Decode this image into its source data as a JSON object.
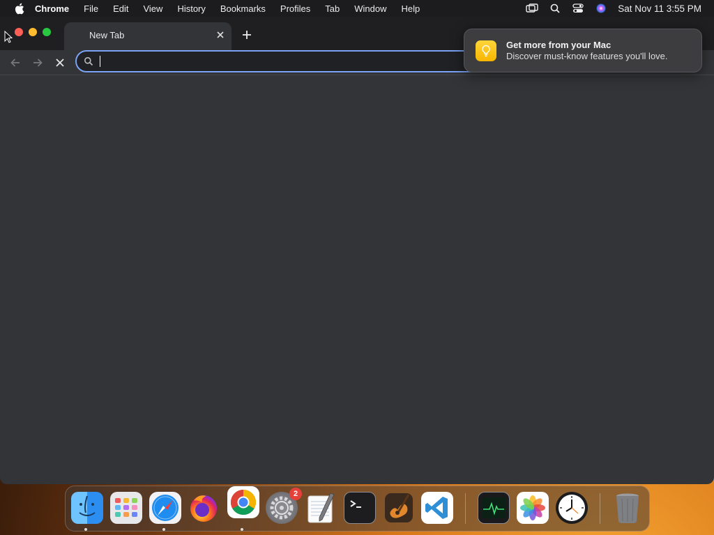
{
  "menubar": {
    "app_name": "Chrome",
    "items": [
      "File",
      "Edit",
      "View",
      "History",
      "Bookmarks",
      "Profiles",
      "Tab",
      "Window",
      "Help"
    ],
    "clock": "Sat Nov 11  3:55 PM"
  },
  "browser": {
    "tab_title": "New Tab",
    "omnibox_value": "",
    "omnibox_placeholder": ""
  },
  "notification": {
    "title": "Get more from your Mac",
    "body": "Discover must-know features you'll love."
  },
  "dock": {
    "apps": [
      {
        "name": "Finder",
        "icon": "finder-icon",
        "running": true
      },
      {
        "name": "Launchpad",
        "icon": "launchpad-icon",
        "running": false
      },
      {
        "name": "Safari",
        "icon": "safari-icon",
        "running": true
      },
      {
        "name": "Firefox",
        "icon": "firefox-icon",
        "running": false
      },
      {
        "name": "Google Chrome",
        "icon": "chrome-icon",
        "running": true
      },
      {
        "name": "System Settings",
        "icon": "settings-icon",
        "running": false,
        "badge": "2"
      },
      {
        "name": "TextEdit",
        "icon": "textedit-icon",
        "running": false
      },
      {
        "name": "Terminal",
        "icon": "terminal-icon",
        "running": false
      },
      {
        "name": "GarageBand",
        "icon": "garageband-icon",
        "running": false
      },
      {
        "name": "Visual Studio Code",
        "icon": "vscode-icon",
        "running": false
      },
      {
        "name": "Activity Monitor",
        "icon": "activity-monitor-icon",
        "running": false
      },
      {
        "name": "Photos",
        "icon": "photos-icon",
        "running": false
      },
      {
        "name": "Clock",
        "icon": "clock-icon",
        "running": false
      },
      {
        "name": "Trash",
        "icon": "trash-icon",
        "running": false
      }
    ]
  },
  "colors": {
    "omnibox_focus": "#7aa3f5",
    "window_bg": "#333437",
    "badge": "#e5403a"
  }
}
